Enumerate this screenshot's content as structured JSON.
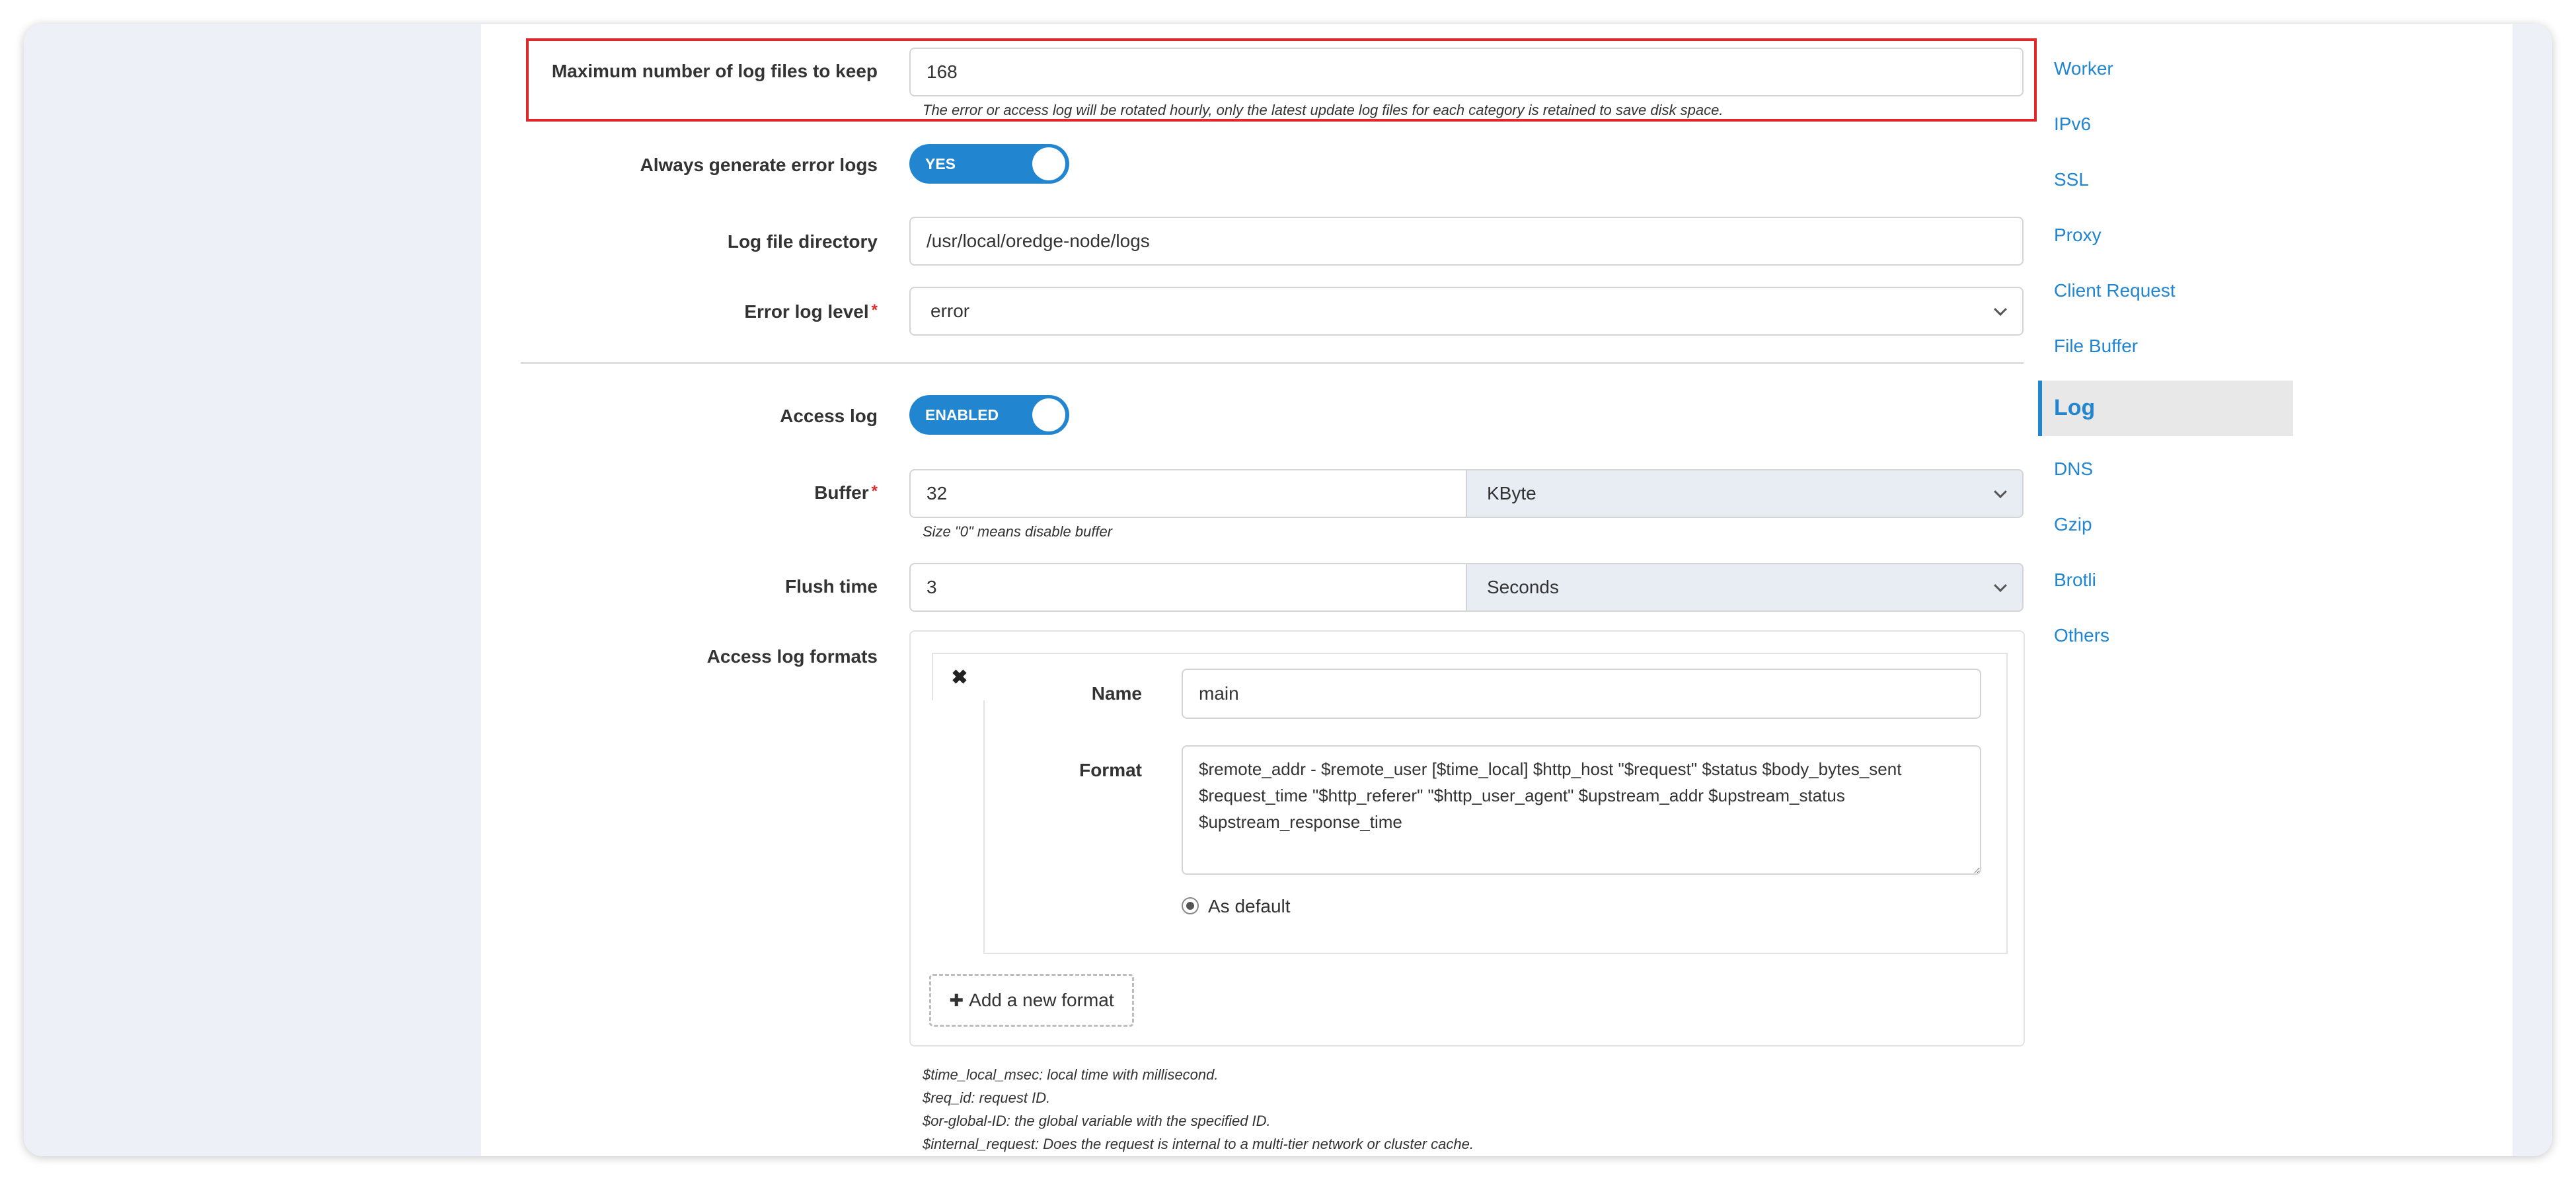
{
  "form": {
    "max_log_files": {
      "label": "Maximum number of log files to keep",
      "value": "168",
      "hint": "The error or access log will be rotated hourly, only the latest update log files for each category is retained to save disk space."
    },
    "always_error_logs": {
      "label": "Always generate error logs",
      "toggle_text": "YES",
      "on": true
    },
    "log_dir": {
      "label": "Log file directory",
      "value": "/usr/local/oredge-node/logs"
    },
    "error_log_level": {
      "label": "Error log level",
      "required_mark": "*",
      "value": "error"
    },
    "access_log": {
      "label": "Access log",
      "toggle_text": "ENABLED",
      "on": true
    },
    "buffer": {
      "label": "Buffer",
      "required_mark": "*",
      "value": "32",
      "unit": "KByte",
      "hint": "Size \"0\" means disable buffer"
    },
    "flush_time": {
      "label": "Flush time",
      "value": "3",
      "unit": "Seconds"
    },
    "access_log_formats": {
      "label": "Access log formats",
      "close_glyph": "✖",
      "items": [
        {
          "name_label": "Name",
          "name_value": "main",
          "format_label": "Format",
          "format_value": "$remote_addr - $remote_user [$time_local] $http_host \"$request\" $status $body_bytes_sent $request_time \"$http_referer\" \"$http_user_agent\" $upstream_addr $upstream_status $upstream_response_time",
          "default_label": "As default",
          "is_default": true
        }
      ],
      "add_button": "Add a new format",
      "add_icon": "✚"
    },
    "footnotes": [
      "$time_local_msec: local time with millisecond.",
      "$req_id: request ID.",
      "$or-global-ID: the global variable with the specified ID.",
      "$internal_request: Does the request is internal to a multi-tier network or cluster cache."
    ]
  },
  "side_nav": {
    "items": [
      {
        "label": "Worker"
      },
      {
        "label": "IPv6"
      },
      {
        "label": "SSL"
      },
      {
        "label": "Proxy"
      },
      {
        "label": "Client Request"
      },
      {
        "label": "File Buffer"
      },
      {
        "label": "Log",
        "active": true
      },
      {
        "label": "DNS"
      },
      {
        "label": "Gzip"
      },
      {
        "label": "Brotli"
      },
      {
        "label": "Others"
      }
    ]
  },
  "colors": {
    "accent": "#2185d0",
    "highlight": "#e0282a",
    "required": "#db2828"
  }
}
